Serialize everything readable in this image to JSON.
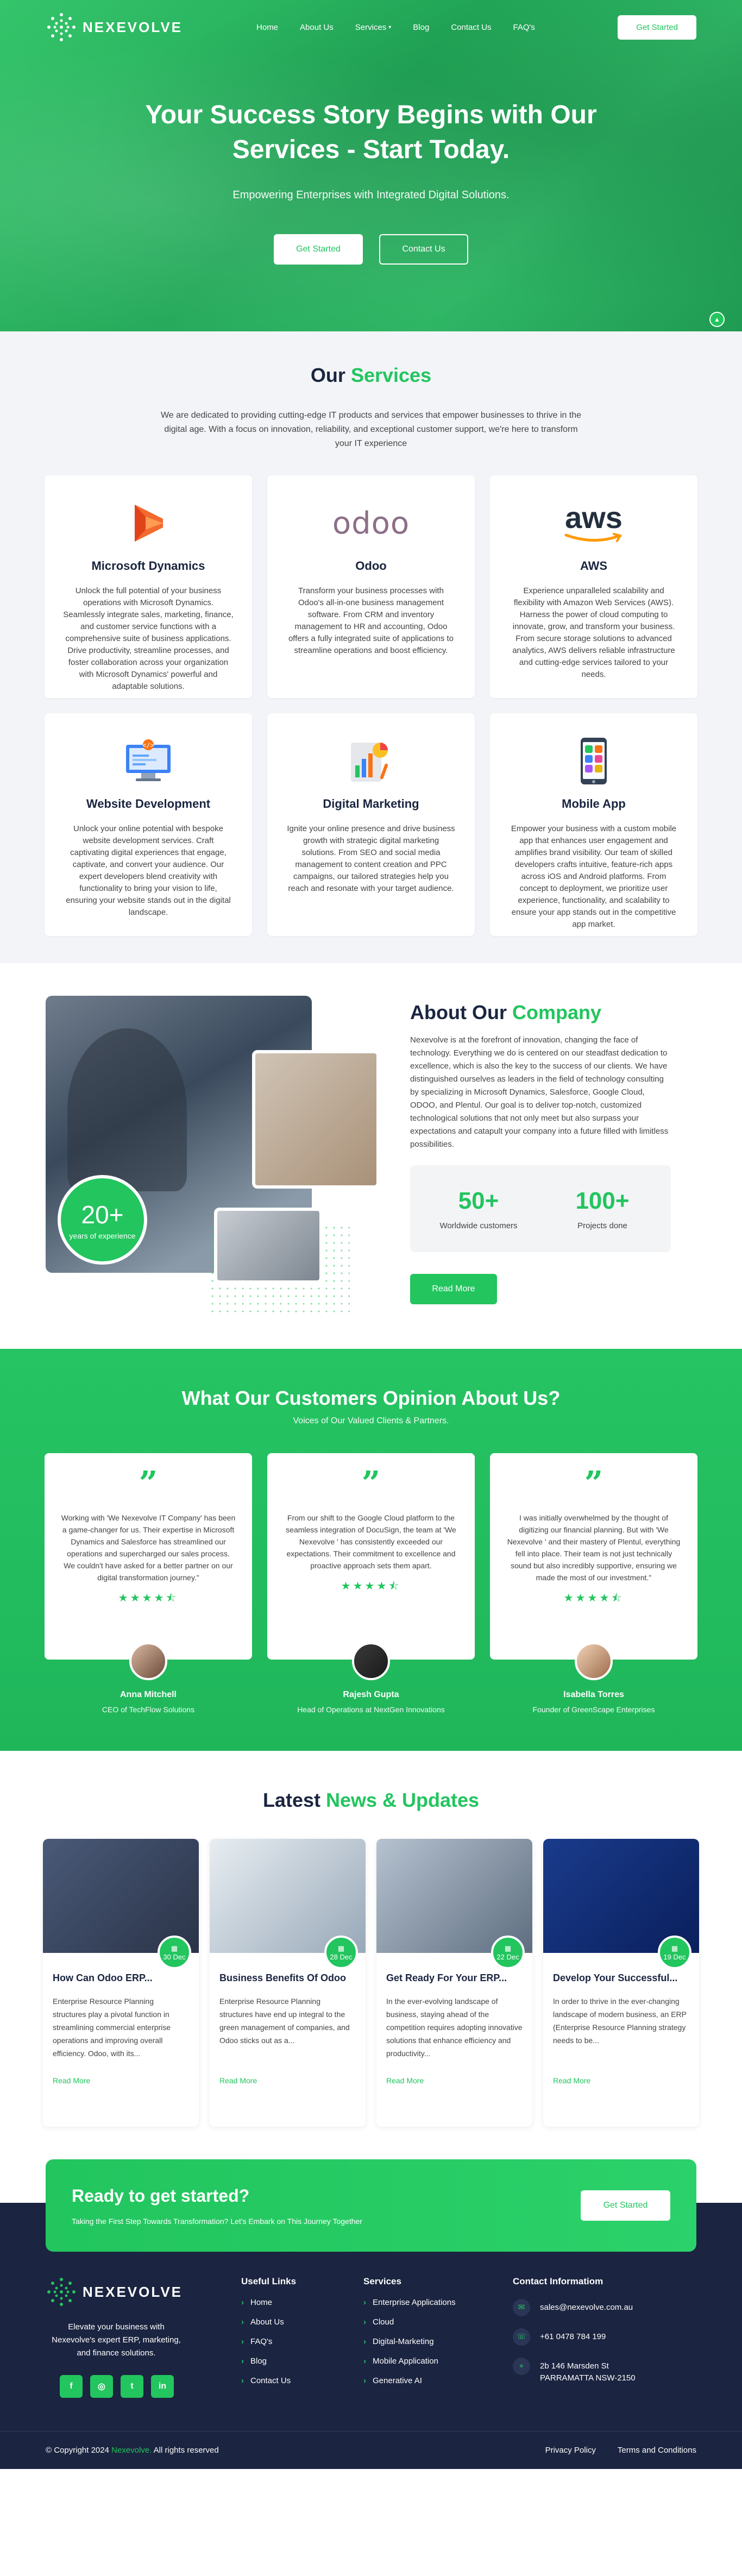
{
  "nav": {
    "logo": "NEXEVOLVE",
    "links": [
      "Home",
      "About Us",
      "Services",
      "Blog",
      "Contact Us",
      "FAQ's"
    ],
    "cta": "Get Started"
  },
  "hero": {
    "title": "Your Success Story Begins with Our Services - Start Today.",
    "subtitle": "Empowering Enterprises with Integrated Digital Solutions.",
    "btn_primary": "Get Started",
    "btn_secondary": "Contact Us"
  },
  "services": {
    "title_a": "Our",
    "title_b": "Services",
    "intro": "We are dedicated to providing cutting-edge IT products and services that empower businesses to thrive in the digital age. With a focus on innovation, reliability, and exceptional customer support, we're here to transform your IT experience",
    "items": [
      {
        "title": "Microsoft Dynamics",
        "icon": "microsoft-dynamics-icon",
        "desc": "Unlock the full potential of your business operations with Microsoft Dynamics. Seamlessly integrate sales, marketing, finance, and customer service functions with a comprehensive suite of business applications. Drive productivity, streamline processes, and foster collaboration across your organization with Microsoft Dynamics' powerful and adaptable solutions."
      },
      {
        "title": "Odoo",
        "icon": "odoo-logo",
        "logo_text": "odoo",
        "desc": "Transform your business processes with Odoo's all-in-one business management software. From CRM and inventory management to HR and accounting, Odoo offers a fully integrated suite of applications to streamline operations and boost efficiency."
      },
      {
        "title": "AWS",
        "icon": "aws-logo",
        "logo_text": "aws",
        "desc": "Experience unparalleled scalability and flexibility with Amazon Web Services (AWS). Harness the power of cloud computing to innovate, grow, and transform your business. From secure storage solutions to advanced analytics, AWS delivers reliable infrastructure and cutting-edge services tailored to your needs."
      },
      {
        "title": "Website Development",
        "icon": "web-dev-icon",
        "desc": "Unlock your online potential with bespoke website development services. Craft captivating digital experiences that engage, captivate, and convert your audience. Our expert developers blend creativity with functionality to bring your vision to life, ensuring your website stands out in the digital landscape."
      },
      {
        "title": "Digital Marketing",
        "icon": "marketing-icon",
        "desc": "Ignite your online presence and drive business growth with strategic digital marketing solutions. From SEO and social media management to content creation and PPC campaigns, our tailored strategies help you reach and resonate with your target audience."
      },
      {
        "title": "Mobile App",
        "icon": "mobile-app-icon",
        "desc": "Empower your business with a custom mobile app that enhances user engagement and amplifies brand visibility. Our team of skilled developers crafts intuitive, feature-rich apps across iOS and Android platforms. From concept to deployment, we prioritize user experience, functionality, and scalability to ensure your app stands out in the competitive app market."
      }
    ]
  },
  "about": {
    "title_a": "About Our",
    "title_b": "Company",
    "desc": "Nexevolve is at the forefront of innovation, changing the face of technology. Everything we do is centered on our steadfast dedication to excellence, which is also the key to the success of our clients. We have distinguished ourselves as leaders in the field of technology consulting by specializing in Microsoft Dynamics, Salesforce, Google Cloud, ODOO, and Plentul. Our goal is to deliver top-notch, customized technological solutions that not only meet but also surpass your expectations and catapult your company into a future filled with limitless possibilities.",
    "badge_num": "20+",
    "badge_label": "years of experience",
    "stats": [
      {
        "num": "50+",
        "label": "Worldwide customers"
      },
      {
        "num": "100+",
        "label": "Projects done"
      }
    ],
    "btn": "Read More"
  },
  "testimonials": {
    "title": "What Our Customers Opinion About Us?",
    "subtitle": "Voices of Our Valued Clients & Partners.",
    "items": [
      {
        "text": "Working with 'We Nexevolve IT Company' has been a game-changer for us. Their expertise in Microsoft Dynamics and Salesforce has streamlined our operations and supercharged our sales process. We couldn't have asked for a better partner on our digital transformation journey.\"",
        "rating": 4.5,
        "name": "Anna Mitchell",
        "role": "CEO of TechFlow Solutions"
      },
      {
        "text": "From our shift to the Google Cloud platform to the seamless integration of DocuSign, the team at 'We Nexevolve ' has consistently exceeded our expectations. Their commitment to excellence and proactive approach sets them apart.",
        "rating": 4.5,
        "name": "Rajesh Gupta",
        "role": "Head of Operations at NextGen Innovations"
      },
      {
        "text": "I was initially overwhelmed by the thought of digitizing our financial planning. But with 'We Nexevolve ' and their mastery of Plentul, everything fell into place. Their team is not just technically sound but also incredibly supportive, ensuring we made the most of our investment.\"",
        "rating": 4.5,
        "name": "Isabella Torres",
        "role": "Founder of GreenScape Enterprises"
      }
    ]
  },
  "news": {
    "title_a": "Latest",
    "title_b": "News & Updates",
    "items": [
      {
        "day": "30",
        "month": "Dec",
        "title": "How Can Odoo ERP...",
        "desc": "Enterprise Resource Planning structures play a pivotal function in streamlining commercial enterprise operations and improving overall efficiency. Odoo, with its...",
        "more": "Read More"
      },
      {
        "day": "28",
        "month": "Dec",
        "title": "Business Benefits Of Odoo",
        "desc": "Enterprise Resource Planning structures have end up integral to the green management of companies, and Odoo sticks out as a...",
        "more": "Read More"
      },
      {
        "day": "22",
        "month": "Dec",
        "title": "Get Ready For Your ERP...",
        "desc": "In the ever-evolving landscape of business, staying ahead of the competition requires adopting innovative solutions that enhance efficiency and productivity...",
        "more": "Read More"
      },
      {
        "day": "19",
        "month": "Dec",
        "title": "Develop Your Successful...",
        "desc": "In order to thrive in the ever-changing landscape of modern business, an ERP (Enterprise Resource Planning strategy needs to be...",
        "more": "Read More"
      }
    ]
  },
  "cta": {
    "title": "Ready to get started?",
    "subtitle": "Taking the First Step Towards Transformation? Let's Embark on This Journey Together",
    "btn": "Get Started"
  },
  "footer": {
    "desc": "Elevate your business with Nexevolve's expert ERP, marketing, and finance solutions.",
    "socials": [
      "f",
      "◎",
      "t",
      "in"
    ],
    "useful_title": "Useful Links",
    "useful": [
      "Home",
      "About Us",
      "FAQ's",
      "Blog",
      "Contact Us"
    ],
    "services_title": "Services",
    "services": [
      "Enterprise Applications",
      "Cloud",
      "Digital-Marketing",
      "Mobile Application",
      "Generative AI"
    ],
    "contact_title": "Contact Informatiom",
    "email": "sales@nexevolve.com.au",
    "phone": "+61 0478 784 199",
    "address": "2b 146 Marsden St PARRAMATTA NSW-2150",
    "copyright_a": "© Copyright 2024",
    "copyright_brand": "Nexevolve.",
    "copyright_b": "All rights reserved",
    "privacy": "Privacy Policy",
    "terms": "Terms and Conditions"
  },
  "colors": {
    "accent": "#22c55e",
    "dark": "#1b2440"
  }
}
